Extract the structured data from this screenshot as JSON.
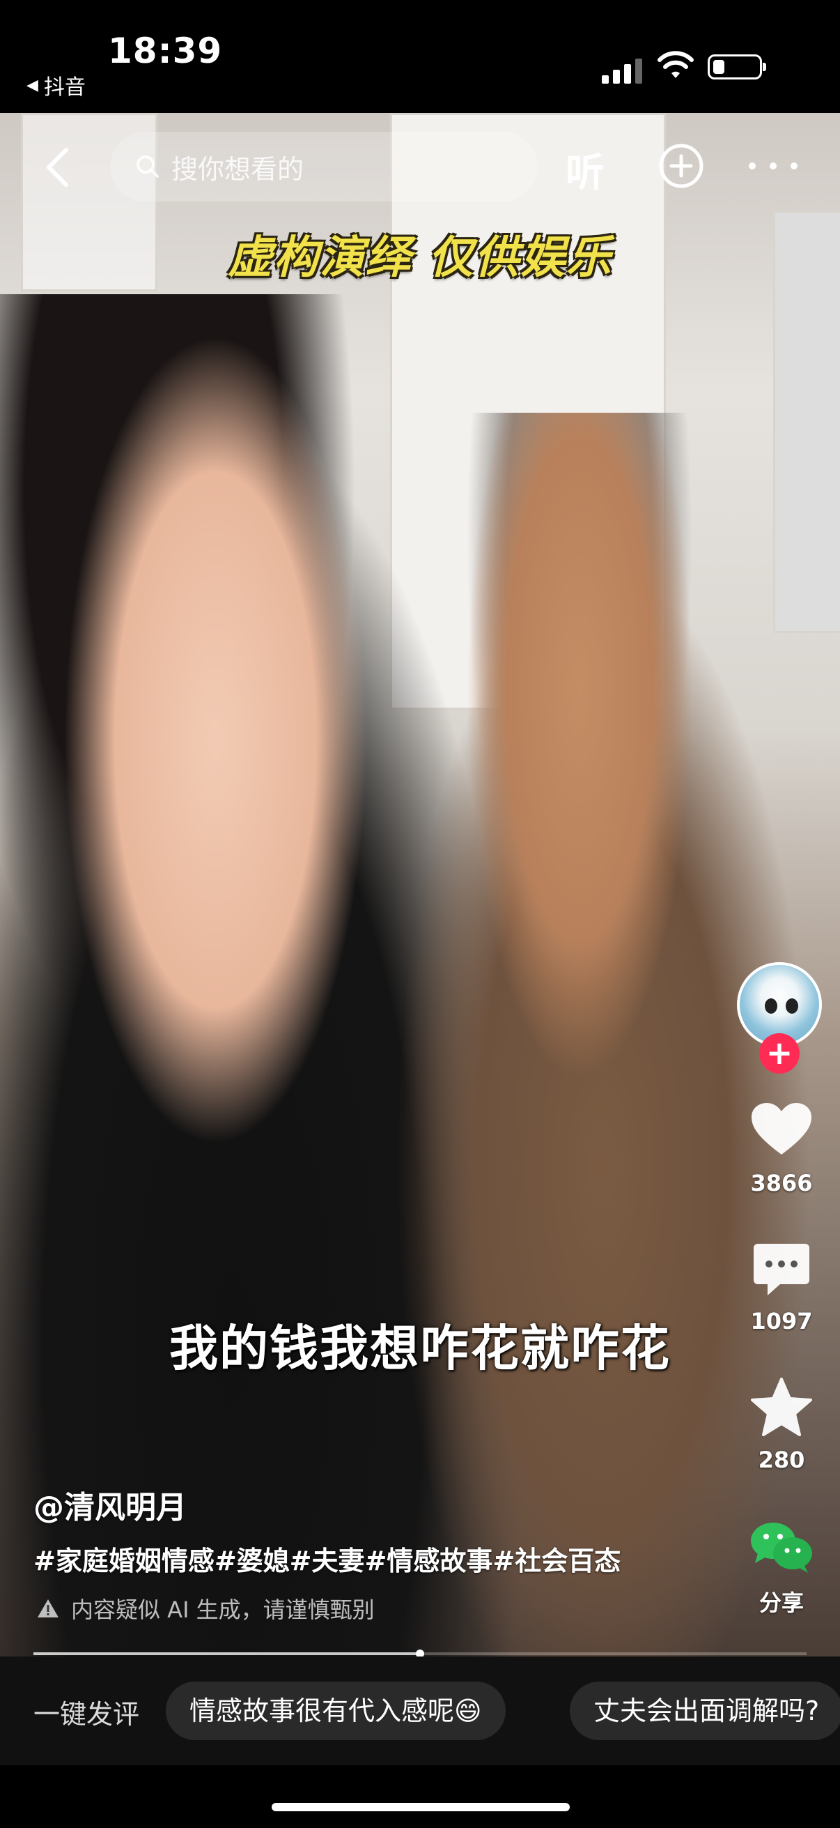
{
  "status_bar": {
    "time": "18:39",
    "back_app": "抖音",
    "icons": [
      "signal-icon",
      "wifi-icon",
      "battery-icon"
    ]
  },
  "top_nav": {
    "search_placeholder": "搜你想看的",
    "listen_label": "听"
  },
  "video": {
    "disclaimer": "虚构演绎 仅供娱乐",
    "subtitle": "我的钱我想咋花就咋花",
    "progress": 0.5
  },
  "actions": {
    "likes": "3866",
    "comments": "1097",
    "favorites": "280",
    "share": "分享"
  },
  "info": {
    "author": "@清风明月",
    "tags": "#家庭婚姻情感#婆媳#夫妻#情感故事#社会百态",
    "ai_notice": "内容疑似 AI 生成，请谨慎甄别"
  },
  "comment_bar": {
    "label": "一键发评",
    "suggestions": [
      "情感故事很有代入感呢😄",
      "丈夫会出面调解吗?"
    ]
  },
  "colors": {
    "accent_red": "#fe2c55",
    "disclaimer_yellow": "#f1e14a"
  }
}
